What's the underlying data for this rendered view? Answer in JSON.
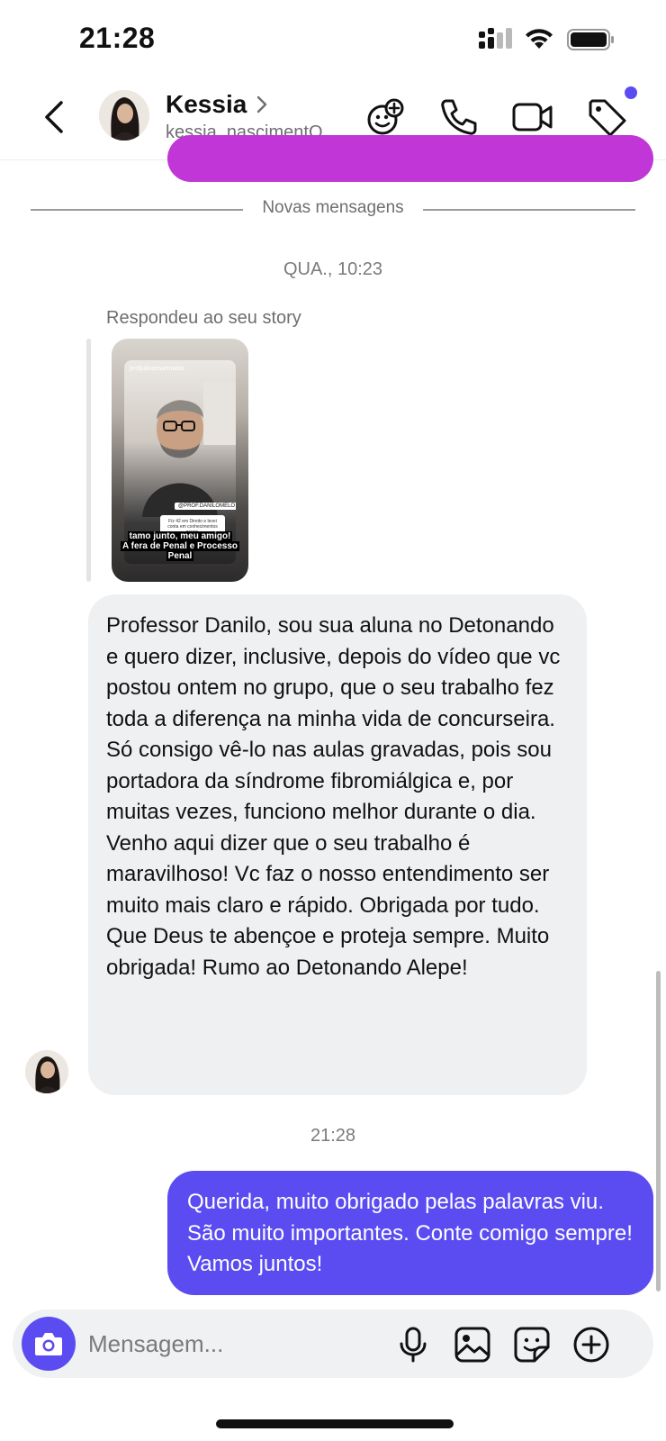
{
  "status_bar": {
    "time": "21:28"
  },
  "header": {
    "contact_name": "Kessia",
    "username": "kessia_nascimentO",
    "icons": [
      "chevron-left-icon",
      "effects-plus-icon",
      "phone-icon",
      "video-icon",
      "tag-icon"
    ],
    "accent": "#5b4cf2"
  },
  "chat": {
    "divider_label": "Novas mensagens",
    "timestamp_1": "QUA., 10:23",
    "story_reply_label": "Respondeu ao seu story",
    "story": {
      "account": "profjuliocesarmatos",
      "tag": "@PROF.DANILOMELO",
      "question": "Fiz 42 em Direito e levei conta em conhecimentos gerais.",
      "caption_lines": [
        "tamo junto, meu amigo!",
        "A fera de Penal e Processo",
        "Penal"
      ]
    },
    "incoming_message": "Professor Danilo, sou sua aluna no Detonando e quero dizer, inclusive, depois do vídeo que vc postou ontem no grupo, que o seu trabalho fez toda a diferença na minha vida de concurseira. Só consigo vê-lo nas aulas gravadas, pois sou portadora da síndrome fibromiálgica e, por muitas vezes, funciono melhor durante o dia. Venho aqui dizer que o seu trabalho é maravilhoso! Vc faz o nosso entendimento ser muito mais claro e rápido. Obrigada por tudo. Que Deus te abençoe e proteja sempre. Muito obrigada! Rumo ao Detonando Alepe!",
    "timestamp_2": "21:28",
    "outgoing_message": "Querida, muito obrigado pelas palavras viu. São muito importantes. Conte comigo sempre! Vamos juntos!",
    "incoming_bubble_color": "#eff0f2",
    "outgoing_bubble_color": "#5b4cf2",
    "previous_bubble_color": "#c036d6"
  },
  "composer": {
    "placeholder": "Mensagem...",
    "icons": [
      "camera-icon",
      "microphone-icon",
      "gallery-icon",
      "sticker-icon",
      "plus-circle-icon"
    ]
  }
}
